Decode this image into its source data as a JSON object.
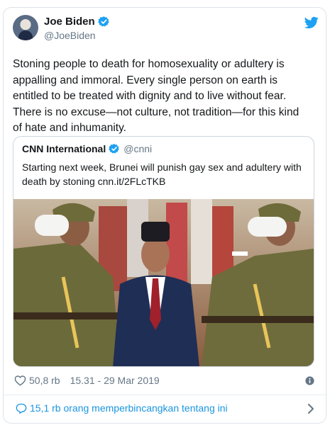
{
  "tweet": {
    "author_name": "Joe Biden",
    "author_handle": "@JoeBiden",
    "text": "Stoning people to death for homosexuality or adultery is appalling and immoral. Every single person on earth is entitled to be treated with dignity and to live without fear. There is no excuse—not culture, not tradition—for this kind of hate and inhumanity.",
    "likes": "50,8 rb",
    "timestamp": "15.31 - 29 Mar 2019"
  },
  "quoted": {
    "author_name": "CNN International",
    "author_handle": "@cnni",
    "text": "Starting next week, Brunei will punish gay sex and adultery with death by stoning cnn.it/2FLcTKB"
  },
  "footer": {
    "conversation_label": "15,1 rb orang memperbincangkan tentang ini"
  },
  "colors": {
    "brand": "#1da1f2",
    "link": "#1b95e0",
    "muted": "#657786"
  },
  "icons": [
    "verified-icon",
    "twitter-bird-icon",
    "heart-icon",
    "info-icon",
    "reply-bubble-icon",
    "chevron-right-icon"
  ]
}
